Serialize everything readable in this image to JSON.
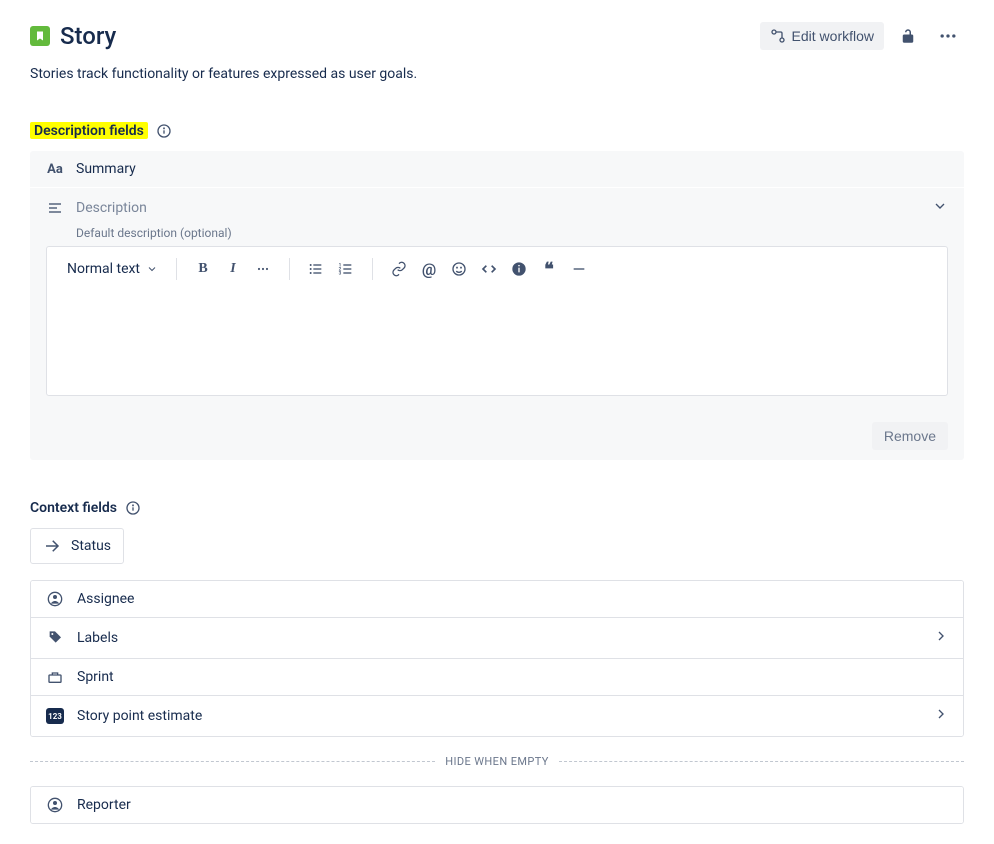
{
  "header": {
    "title": "Story",
    "edit_workflow": "Edit workflow"
  },
  "subtitle": "Stories track functionality or features expressed as user goals.",
  "sections": {
    "description_fields": "Description fields",
    "context_fields": "Context fields"
  },
  "description_panel": {
    "summary_label": "Summary",
    "description_label": "Description",
    "default_hint": "Default description (optional)",
    "text_style": "Normal text",
    "remove": "Remove"
  },
  "context": {
    "status": "Status",
    "assignee": "Assignee",
    "labels": "Labels",
    "sprint": "Sprint",
    "story_point_estimate": "Story point estimate",
    "hide_when_empty": "HIDE WHEN EMPTY",
    "reporter": "Reporter"
  },
  "icons": {
    "spe_badge": "123"
  }
}
